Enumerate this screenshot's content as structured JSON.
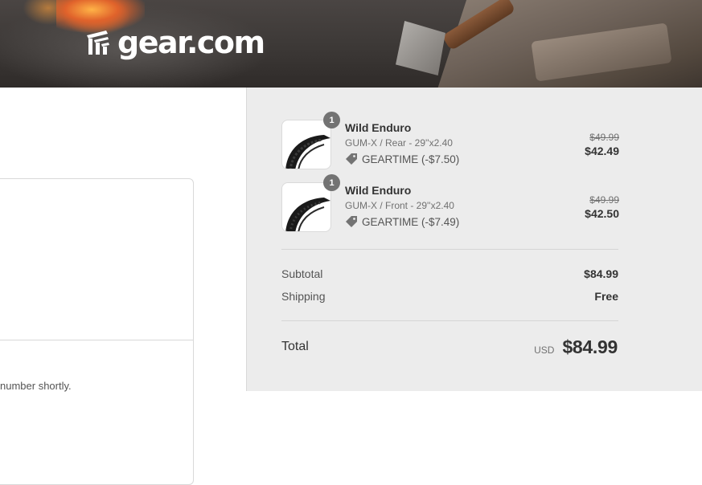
{
  "brand": {
    "logo_text": "gear.com",
    "logo_icon": "gear-logo-icon"
  },
  "main": {
    "partial_note": "number shortly."
  },
  "order_summary": {
    "items": [
      {
        "quantity": "1",
        "name": "Wild Enduro",
        "variant": "GUM-X / Rear - 29''x2.40",
        "discount": "GEARTIME (-$7.50)",
        "original_price": "$49.99",
        "price": "$42.49",
        "image_icon": "tire-icon"
      },
      {
        "quantity": "1",
        "name": "Wild Enduro",
        "variant": "GUM-X / Front - 29''x2.40",
        "discount": "GEARTIME (-$7.49)",
        "original_price": "$49.99",
        "price": "$42.50",
        "image_icon": "tire-icon"
      }
    ],
    "subtotal_label": "Subtotal",
    "subtotal_value": "$84.99",
    "shipping_label": "Shipping",
    "shipping_value": "Free",
    "total_label": "Total",
    "currency": "USD",
    "total_value": "$84.99"
  },
  "colors": {
    "summary_bg": "#ececec",
    "qty_badge": "#737373",
    "text_primary": "#333333",
    "text_muted": "#717171"
  }
}
